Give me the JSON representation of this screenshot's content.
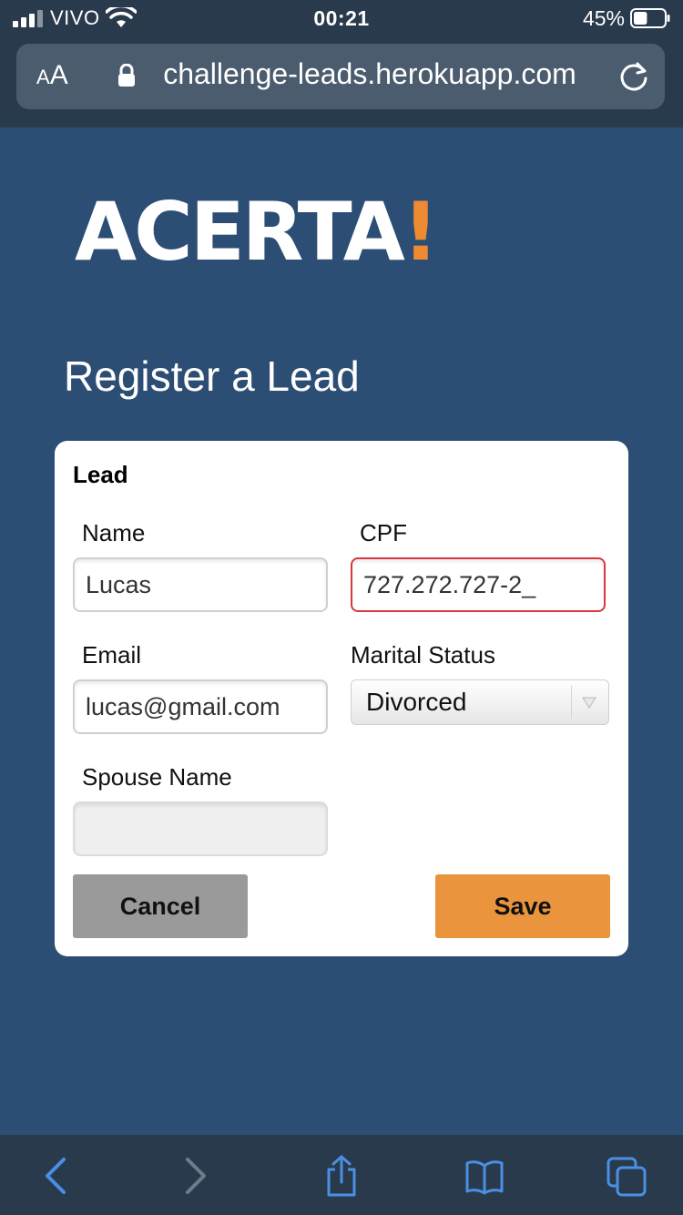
{
  "status_bar": {
    "carrier": "VIVO",
    "time": "00:21",
    "battery": "45%",
    "battery_level": 0.45
  },
  "browser": {
    "text_size_label": "AA",
    "url": "challenge-leads.herokuapp.com"
  },
  "logo": {
    "text": "ACERTA",
    "accent": "!",
    "accent_color": "#ee8b32"
  },
  "page": {
    "title": "Register a Lead"
  },
  "form": {
    "section_title": "Lead",
    "name": {
      "label": "Name",
      "value": "Lucas"
    },
    "cpf": {
      "label": "CPF",
      "value": "727.272.727-2_"
    },
    "email": {
      "label": "Email",
      "value": "lucas@gmail.com"
    },
    "marital_status": {
      "label": "Marital Status",
      "value": "Divorced"
    },
    "spouse_name": {
      "label": "Spouse Name",
      "value": ""
    },
    "cancel_label": "Cancel",
    "save_label": "Save"
  },
  "colors": {
    "page_background": "#2d4e74",
    "browser_chrome": "#2a3a4d",
    "save_button": "#ea943e",
    "cancel_button": "#9a9a9a",
    "error_border": "#d9393d",
    "toolbar_icon_active": "#4a90e2",
    "toolbar_icon_disabled": "#6f7b89"
  },
  "toolbar": {
    "icons": [
      "back-icon",
      "forward-icon",
      "share-icon",
      "bookmarks-icon",
      "tabs-icon"
    ]
  }
}
